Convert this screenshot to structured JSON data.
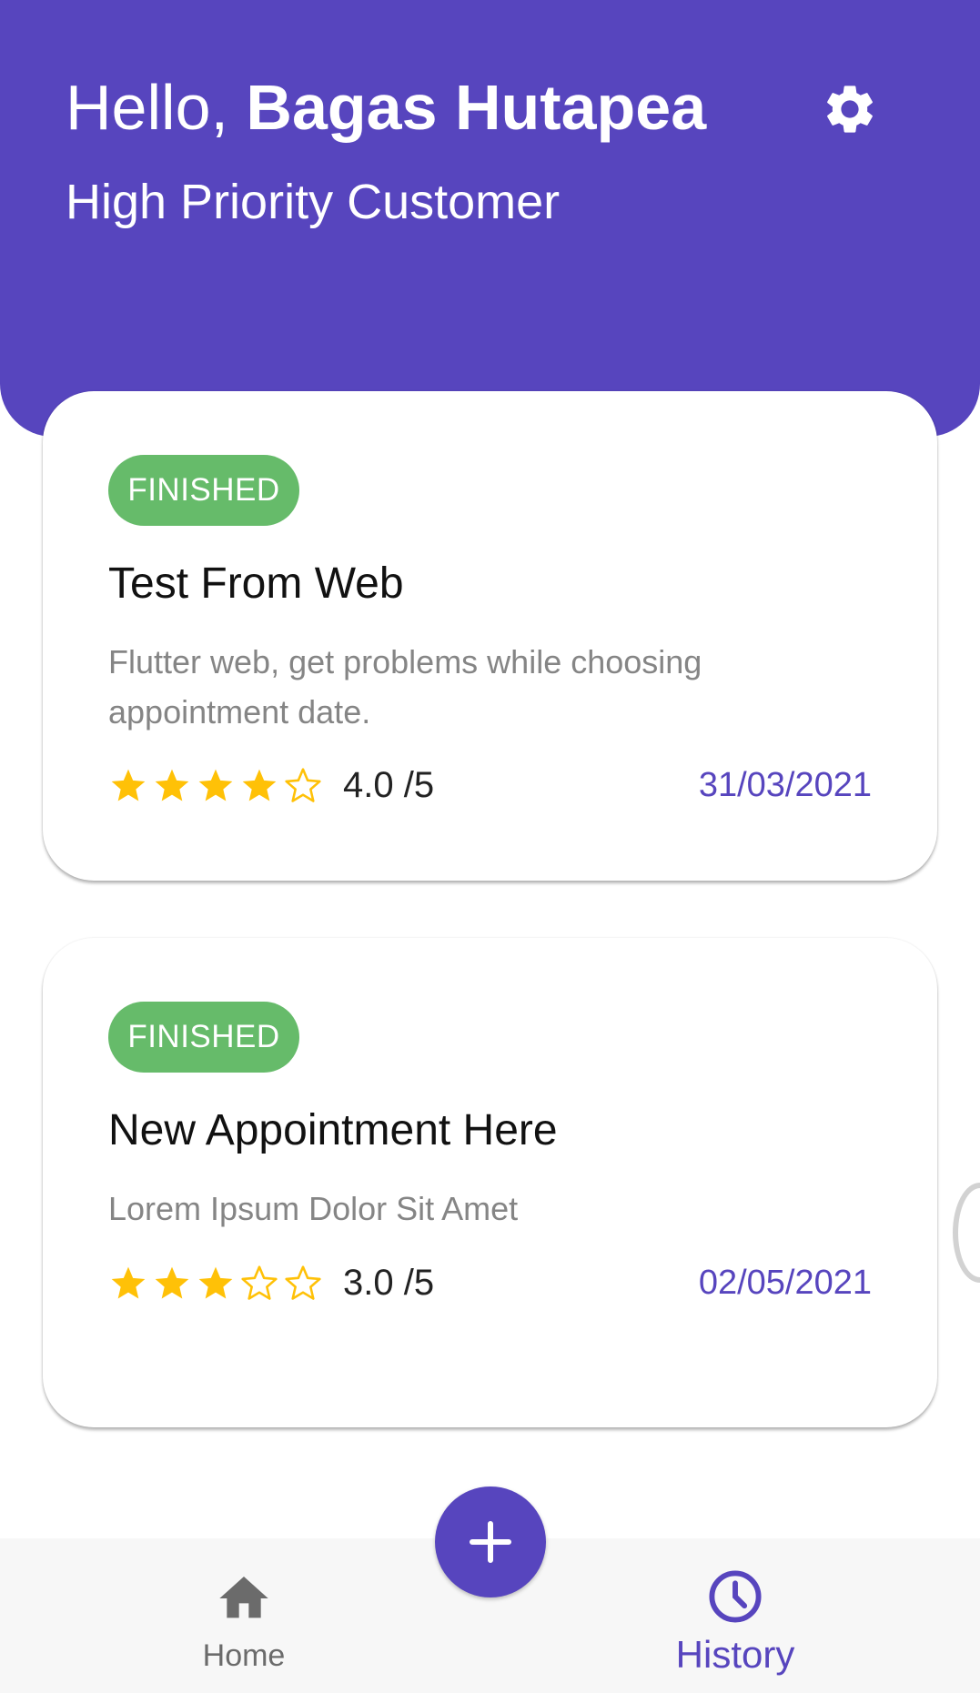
{
  "header": {
    "greeting_prefix": "Hello, ",
    "user_name": "Bagas Hutapea",
    "subtitle": "High Priority Customer",
    "settings_icon": "gear-icon"
  },
  "appointments": [
    {
      "status": "FINISHED",
      "title": "Test From Web",
      "description": "Flutter web, get problems while choosing appointment date.",
      "rating": 4,
      "rating_text": "4.0 /5",
      "date": "31/03/2021"
    },
    {
      "status": "FINISHED",
      "title": "New Appointment Here",
      "description": "Lorem Ipsum Dolor Sit Amet",
      "rating": 3,
      "rating_text": "3.0 /5",
      "date": "02/05/2021"
    }
  ],
  "fab": {
    "icon": "plus-icon"
  },
  "bottom_nav": {
    "items": [
      {
        "label": "Home",
        "icon": "home-icon",
        "active": false
      },
      {
        "label": "History",
        "icon": "clock-icon",
        "active": true
      }
    ]
  },
  "colors": {
    "primary": "#5745BE",
    "status_finished": "#66BB6A",
    "star": "#FFC107",
    "date_text": "#5745BE"
  }
}
